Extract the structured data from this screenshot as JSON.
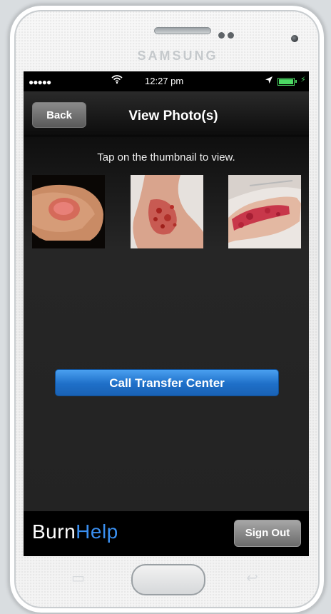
{
  "device": {
    "brand": "SAMSUNG"
  },
  "status_bar": {
    "signal": "●●●●●",
    "wifi_icon": "wifi-icon",
    "time": "12:27 pm",
    "location_icon": "location-arrow-icon",
    "battery_icon": "battery-charging-icon",
    "battery_color": "#4cd964"
  },
  "nav": {
    "back_label": "Back",
    "title": "View Photo(s)"
  },
  "content": {
    "instruction": "Tap on the thumbnail to view.",
    "thumbnails": [
      {
        "label": "burn photo 1"
      },
      {
        "label": "burn photo 2"
      },
      {
        "label": "burn photo 3"
      }
    ],
    "call_button_label": "Call Transfer Center",
    "accent_color": "#1e6fc8"
  },
  "footer": {
    "logo_part1": "Burn",
    "logo_part2": "Help",
    "signout_label": "Sign Out"
  }
}
